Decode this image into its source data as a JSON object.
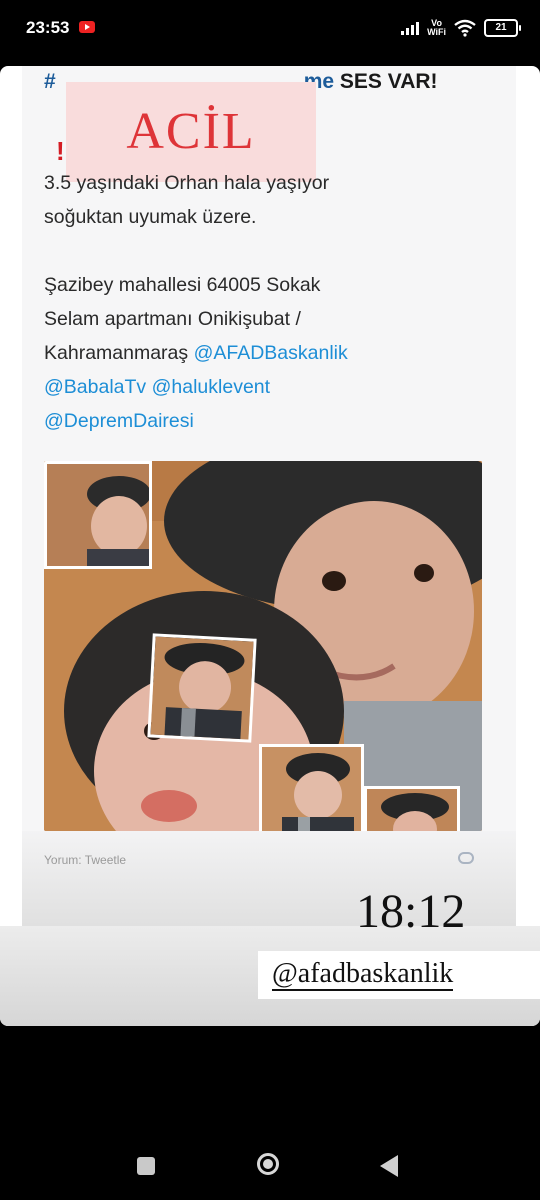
{
  "status_bar": {
    "time": "23:53",
    "network_label_1": "Vo",
    "network_label_2": "WiFi",
    "battery_level": "21"
  },
  "story": {
    "overlay_title": "ACİL",
    "hashtag_fragment_left": "#",
    "hashtag_fragment_me": "me",
    "hashtag_tail": "SES VAR!",
    "tweet_lines": [
      "3.5 yaşındaki Orhan hala yaşıyor",
      "soğuktan uyumak üzere."
    ],
    "address_lines": [
      "Şazibey mahallesi 64005 Sokak",
      "Selam apartmanı Onikişubat /"
    ],
    "address_city": "Kahramanmaraş",
    "mentions_line_1": "@AFADBaskanlik",
    "mentions_line_2a": "@BabalaTv",
    "mentions_line_2b": "@haluklevent",
    "mentions_line_3": "@DepremDairesi",
    "faded_footer": "Yorum: Tweetle",
    "clock": "18:12",
    "handle": "@afadbaskanlik"
  },
  "colors": {
    "acil_red": "#de3438",
    "acil_bg": "#f9dcdc",
    "mention_blue": "#1d8ed6"
  }
}
